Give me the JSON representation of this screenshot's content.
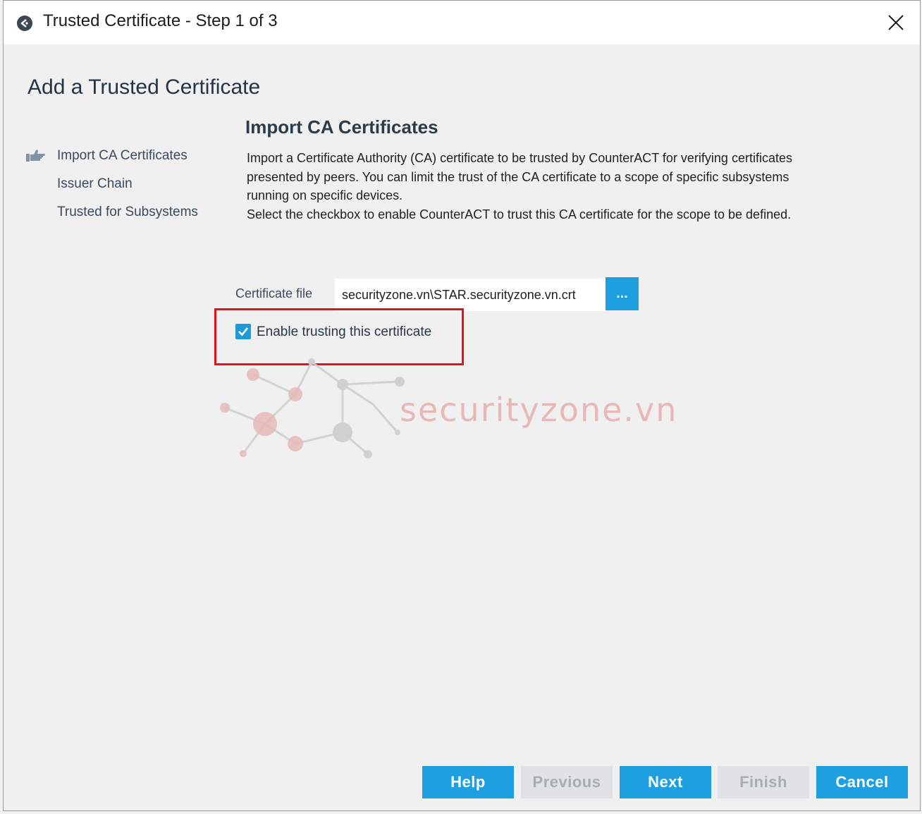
{
  "window": {
    "title": "Trusted Certificate - Step 1 of 3"
  },
  "page": {
    "title": "Add a Trusted Certificate"
  },
  "steps": [
    {
      "label": "Import CA Certificates",
      "current": true
    },
    {
      "label": "Issuer Chain",
      "current": false
    },
    {
      "label": "Trusted for Subsystems",
      "current": false
    }
  ],
  "section": {
    "title": "Import CA Certificates",
    "description_lines": [
      "Import a Certificate Authority (CA) certificate to be trusted by CounterACT for verifying certificates",
      "presented by peers. You can limit the trust of the CA certificate to a scope of specific subsystems",
      "running on specific devices.",
      "Select the checkbox to enable CounterACT to trust this CA certificate for the scope to be defined."
    ]
  },
  "certificate": {
    "label": "Certificate file",
    "value": "securityzone.vn\\STAR.securityzone.vn.crt",
    "browse_label": "..."
  },
  "trust_checkbox": {
    "label": "Enable trusting this certificate",
    "checked": true
  },
  "watermark": {
    "text": "securityzone.vn"
  },
  "buttons": {
    "help": "Help",
    "previous": "Previous",
    "next": "Next",
    "finish": "Finish",
    "cancel": "Cancel"
  },
  "colors": {
    "accent": "#1ea0e0",
    "highlight": "#e0141b",
    "disabled_bg": "#e0e3e6"
  }
}
